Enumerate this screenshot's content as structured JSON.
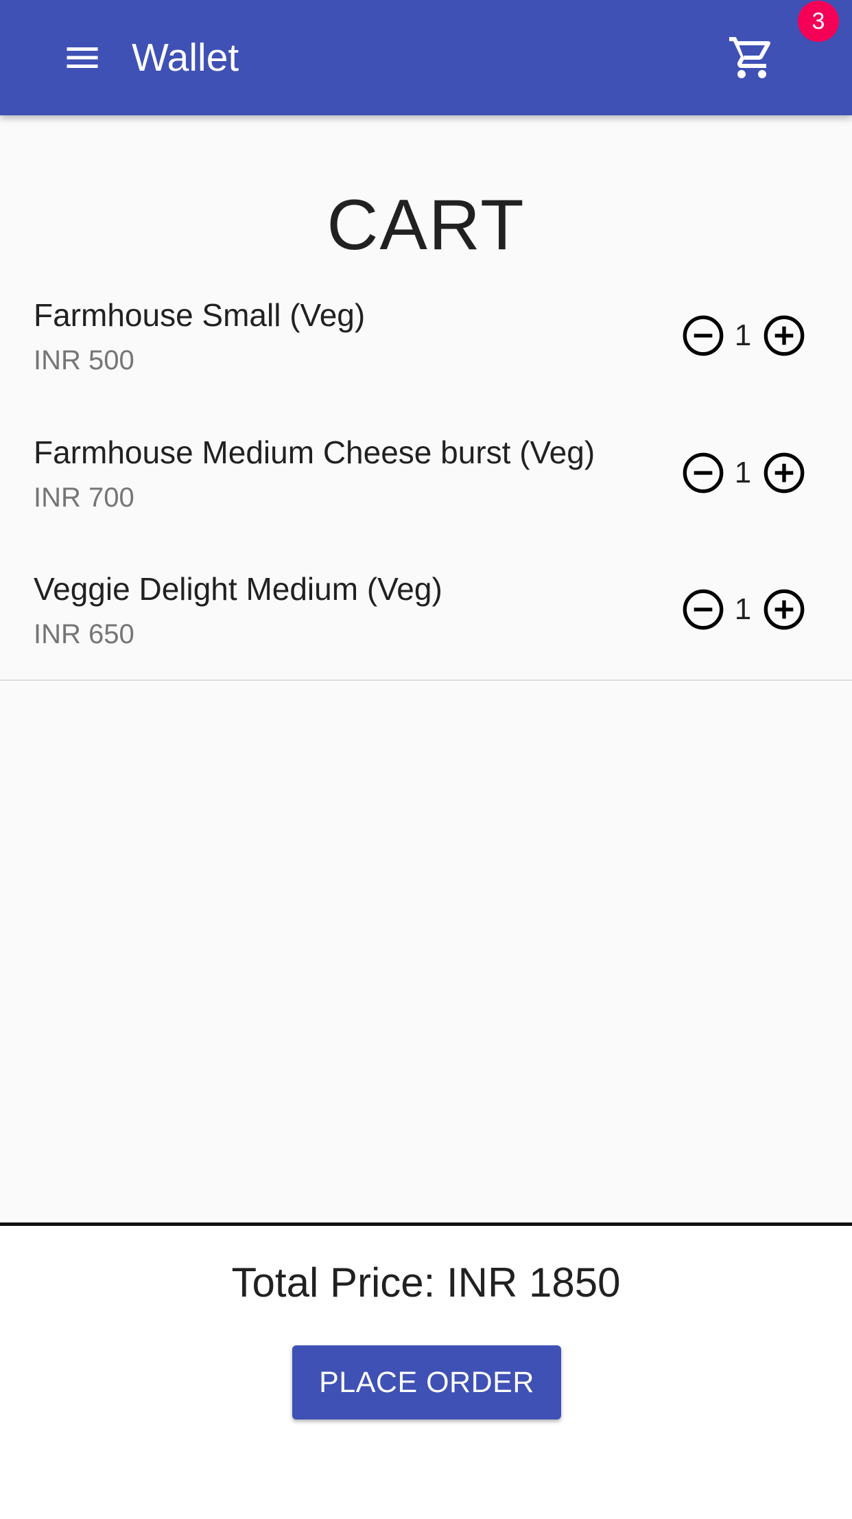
{
  "app_bar": {
    "title": "Wallet",
    "menu_icon": "menu-icon",
    "cart_icon": "shopping-cart-icon",
    "cart_badge_count": "3",
    "background_color": "#3f51b5",
    "badge_color": "#f50057"
  },
  "cart": {
    "heading": "CART",
    "items": [
      {
        "name": "Farmhouse Small (Veg)",
        "price": "INR 500",
        "quantity": "1"
      },
      {
        "name": "Farmhouse Medium Cheese burst (Veg)",
        "price": "INR 700",
        "quantity": "1"
      },
      {
        "name": "Veggie Delight Medium (Veg)",
        "price": "INR 650",
        "quantity": "1"
      }
    ],
    "decrement_icon": "minus-circle-icon",
    "increment_icon": "plus-circle-icon"
  },
  "summary": {
    "total_price": "Total Price: INR 1850",
    "place_order_label": "PLACE ORDER",
    "button_color": "#3f51b5"
  }
}
